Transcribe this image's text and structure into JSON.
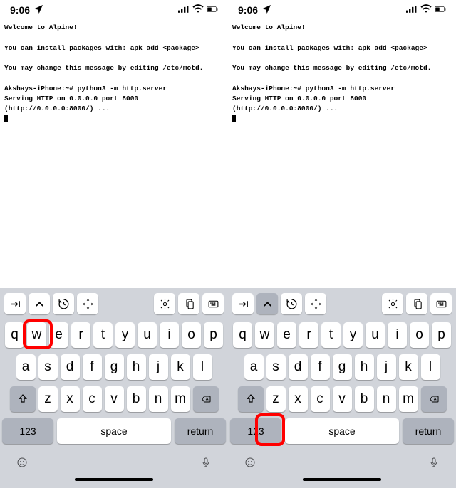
{
  "status": {
    "time": "9:06",
    "location_icon": "location-arrow",
    "signal": "signal-bars",
    "wifi": "wifi-icon",
    "battery": "battery-half"
  },
  "terminal": {
    "line1": "Welcome to Alpine!",
    "line2": "You can install packages with: apk add <package>",
    "line3": "You may change this message by editing /etc/motd.",
    "line4": "Akshays-iPhone:~# python3 -m http.server",
    "line5": "Serving HTTP on 0.0.0.0 port 8000 (http://0.0.0.0:8000/) ..."
  },
  "toolbar": {
    "tab_icon": "tab-right",
    "ctrl_icon": "chevron-up",
    "history_icon": "clock-back",
    "arrows_icon": "move-arrows",
    "gear_icon": "gear",
    "paste_icon": "clipboard",
    "kb_icon": "keyboard"
  },
  "keyboard": {
    "row1": [
      "q",
      "w",
      "e",
      "r",
      "t",
      "y",
      "u",
      "i",
      "o",
      "p"
    ],
    "row2": [
      "a",
      "s",
      "d",
      "f",
      "g",
      "h",
      "j",
      "k",
      "l"
    ],
    "row3": [
      "z",
      "x",
      "c",
      "v",
      "b",
      "n",
      "m"
    ],
    "num_label": "123",
    "space_label": "space",
    "return_label": "return",
    "emoji": "😀",
    "mic": "🎤"
  },
  "highlights": {
    "left_target": "ctrl-key-toolbar",
    "right_target": "z-key"
  }
}
